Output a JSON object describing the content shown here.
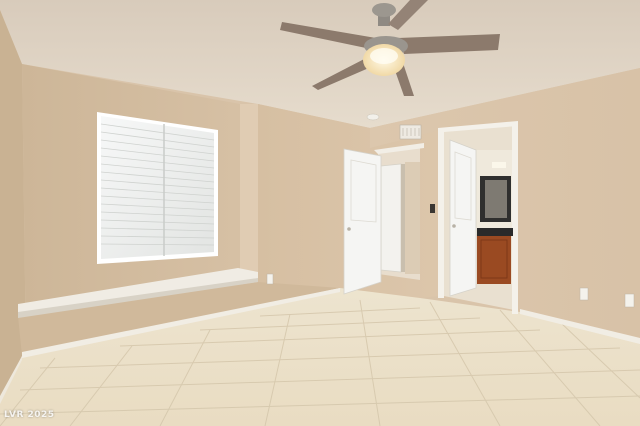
{
  "watermark": {
    "text": "LVR 2025"
  },
  "room": {
    "wall_color": "#d9c2a6",
    "ceiling_color": "#e2d6c6",
    "floor_color": "#ece2cc",
    "trim_color": "#f2efe8",
    "door_color": "#f4f4f2",
    "vanity_color": "#9a4a22"
  }
}
